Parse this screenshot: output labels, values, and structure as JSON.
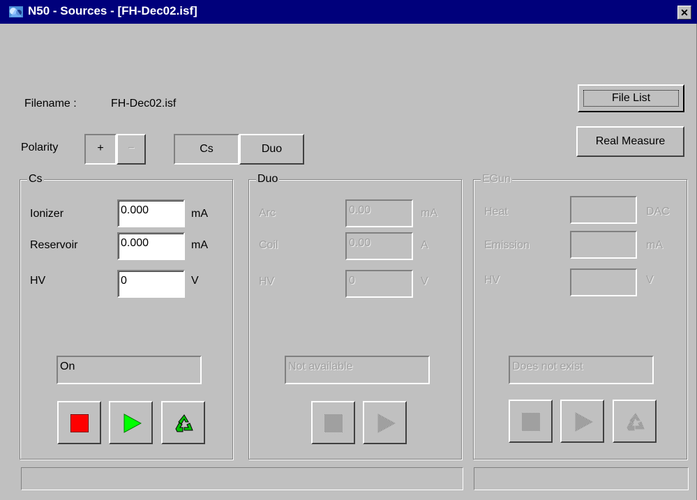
{
  "window": {
    "title": "N50 - Sources - [FH-Dec02.isf]",
    "close_glyph": "✕"
  },
  "file": {
    "label": "Filename :",
    "value": "FH-Dec02.isf"
  },
  "buttons": {
    "file_list": "File List",
    "real_measure": "Real Measure"
  },
  "polarity": {
    "label": "Polarity",
    "plus": "+",
    "minus": "−"
  },
  "source_select": {
    "cs": "Cs",
    "duo": "Duo"
  },
  "cs_panel": {
    "title": "Cs",
    "rows": [
      {
        "label": "Ionizer",
        "value": "0.000",
        "unit": "mA"
      },
      {
        "label": "Reservoir",
        "value": "0.000",
        "unit": "mA"
      },
      {
        "label": "HV",
        "value": "0",
        "unit": "V"
      }
    ],
    "status": "On",
    "controls": [
      "stop-icon",
      "play-icon",
      "recycle-icon"
    ],
    "colors": {
      "stop": "#ff0000",
      "play": "#00ff00",
      "recycle": "#008000"
    }
  },
  "duo_panel": {
    "title": "Duo",
    "rows": [
      {
        "label": "Arc",
        "value": "0.00",
        "unit": "mA"
      },
      {
        "label": "Coil",
        "value": "0.00",
        "unit": "A"
      },
      {
        "label": "HV",
        "value": "0",
        "unit": "V"
      }
    ],
    "status": "Not available",
    "controls": [
      "stop-icon",
      "play-icon"
    ]
  },
  "egun_panel": {
    "title": "EGun",
    "rows": [
      {
        "label": "Heat",
        "value": "",
        "unit": "DAC"
      },
      {
        "label": "Emission",
        "value": "",
        "unit": "mA"
      },
      {
        "label": "HV",
        "value": "",
        "unit": "V"
      }
    ],
    "status": "Does not exist",
    "controls": [
      "stop-icon",
      "play-icon",
      "recycle-icon"
    ]
  },
  "status_bar": {
    "left": "",
    "right": ""
  }
}
